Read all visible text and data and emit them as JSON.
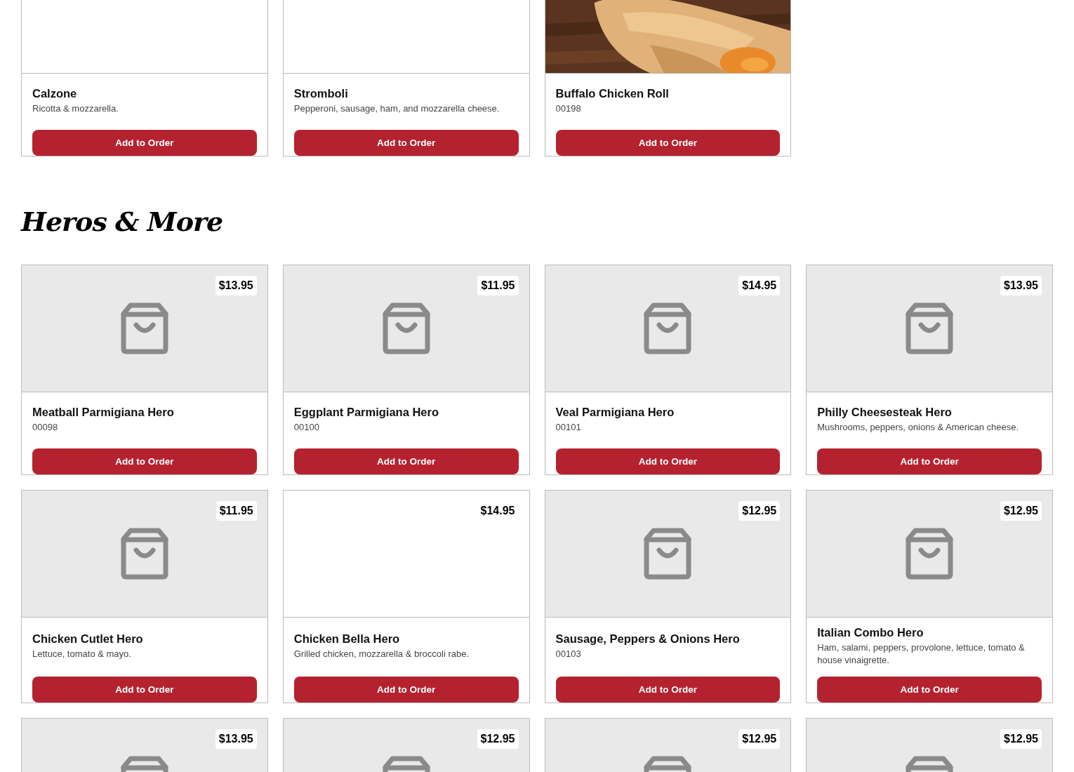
{
  "sections": [
    {
      "cards": [
        {
          "kind": "blank",
          "name": "Calzone",
          "description": "Ricotta & mozzarella.",
          "button": "Add to Order"
        },
        {
          "kind": "blank",
          "name": "Stromboli",
          "description": "Pepperoni, sausage, ham, and mozzarella cheese.",
          "button": "Add to Order"
        },
        {
          "name": "Buffalo Chicken Roll",
          "description": "00198",
          "button": "Add to Order"
        }
      ]
    },
    {
      "title": "Heros & More",
      "cards": [
        {
          "kind": "placeholder",
          "price": "$13.95",
          "name": "Meatball Parmigiana Hero",
          "description": "00098",
          "button": "Add to Order"
        },
        {
          "kind": "placeholder",
          "price": "$11.95",
          "name": "Eggplant Parmigiana Hero",
          "description": "00100",
          "button": "Add to Order"
        },
        {
          "kind": "placeholder",
          "price": "$14.95",
          "name": "Veal Parmigiana Hero",
          "description": "00101",
          "button": "Add to Order"
        },
        {
          "kind": "placeholder",
          "price": "$13.95",
          "name": "Philly Cheesesteak Hero",
          "description": "Mushrooms, peppers, onions & American cheese.",
          "button": "Add to Order"
        },
        {
          "kind": "placeholder",
          "price": "$11.95",
          "name": "Chicken Cutlet Hero",
          "description": "Lettuce, tomato & mayo.",
          "button": "Add to Order"
        },
        {
          "kind": "blank",
          "price": "$14.95",
          "name": "Chicken Bella Hero",
          "description": "Grilled chicken, mozzarella & broccoli rabe.",
          "button": "Add to Order"
        },
        {
          "kind": "placeholder",
          "price": "$12.95",
          "name": "Sausage, Peppers & Onions Hero",
          "description": "00103",
          "button": "Add to Order"
        },
        {
          "kind": "placeholder",
          "price": "$12.95",
          "name": "Italian Combo Hero",
          "description": "Ham, salami, peppers, provolone, lettuce, tomato & house vinaigrette.",
          "button": "Add to Order"
        },
        {
          "kind": "placeholder",
          "price": "$13.95"
        },
        {
          "kind": "placeholder",
          "price": "$12.95"
        },
        {
          "kind": "placeholder",
          "price": "$12.95"
        },
        {
          "kind": "placeholder",
          "price": "$12.95"
        }
      ]
    }
  ]
}
